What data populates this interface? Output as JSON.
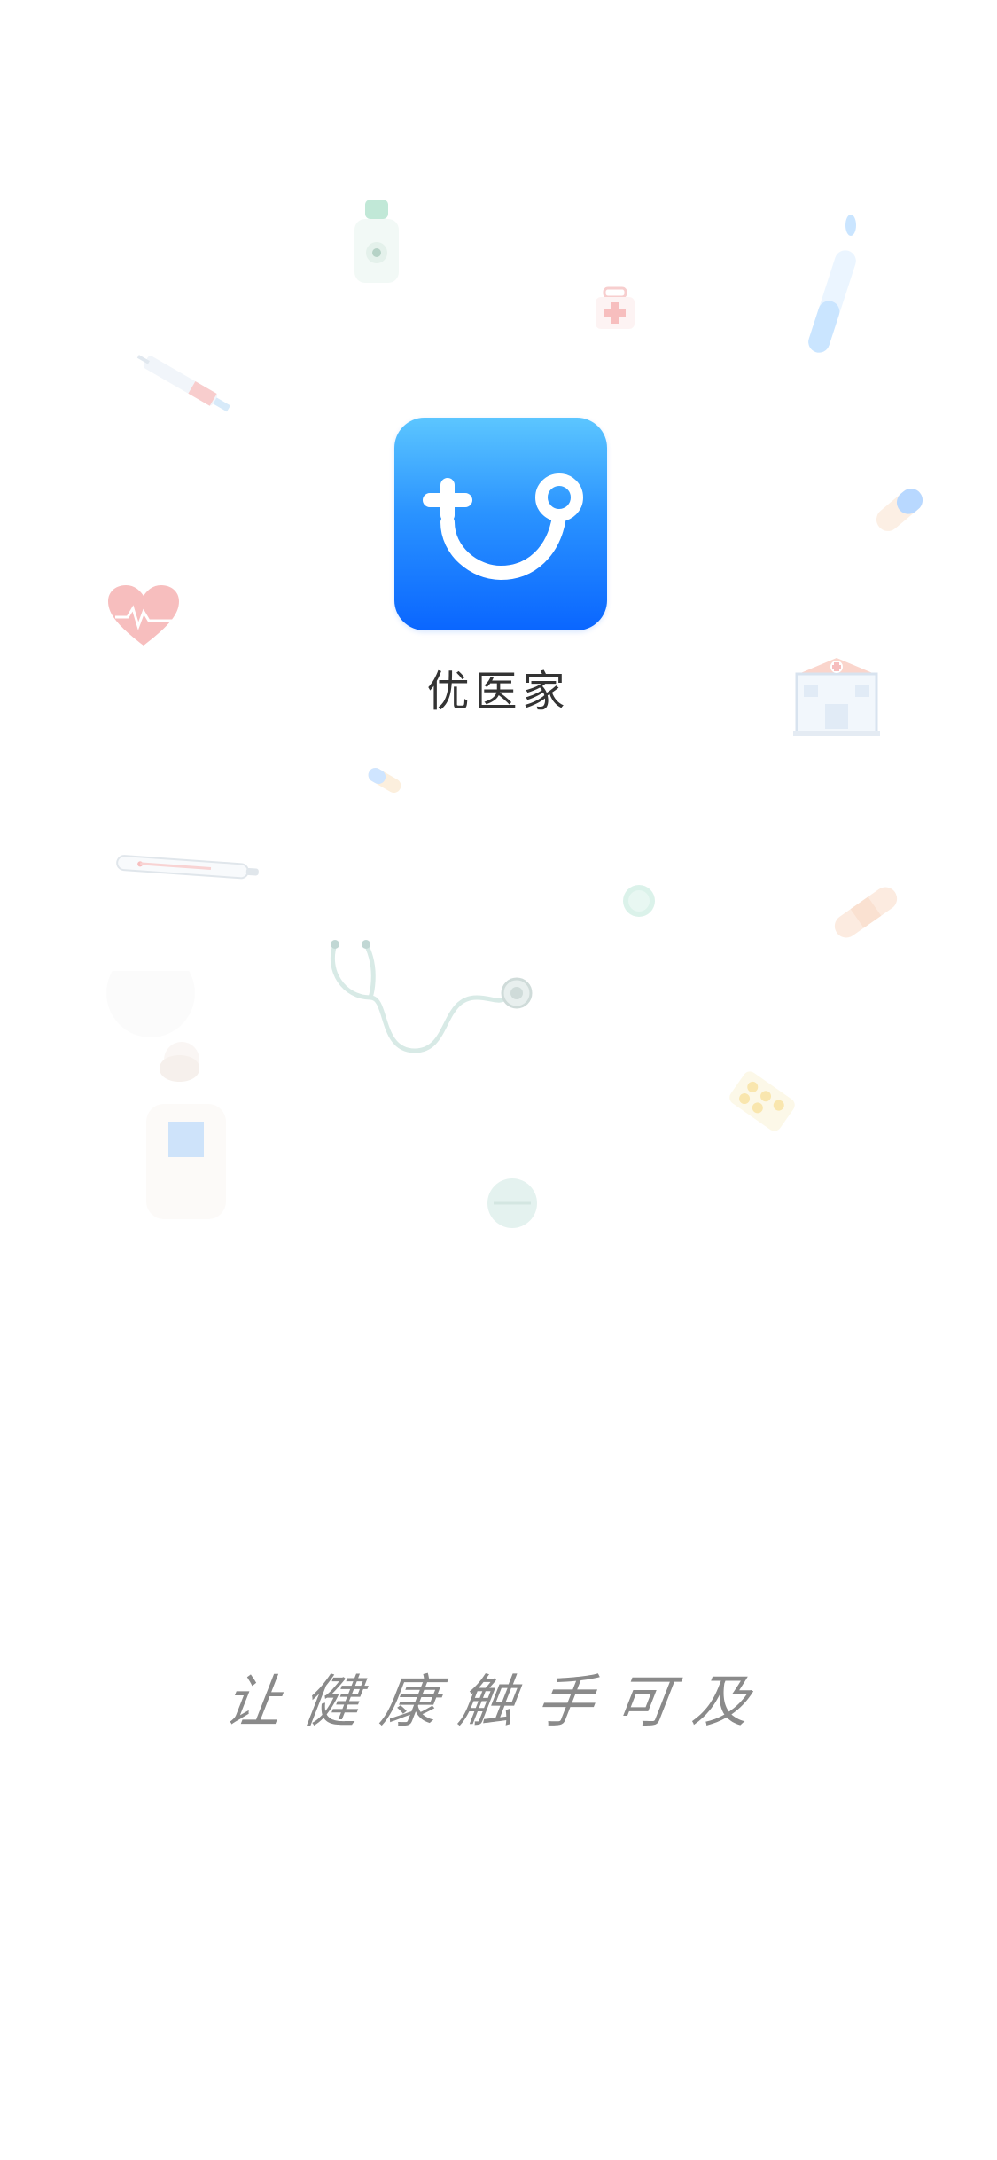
{
  "splash": {
    "app_name": "优医家",
    "slogan": "让健康触手可及"
  },
  "brand": {
    "icon_gradient_top": "#5cc6ff",
    "icon_gradient_bottom": "#0a66ff",
    "icon": "stethoscope-smile-icon"
  }
}
